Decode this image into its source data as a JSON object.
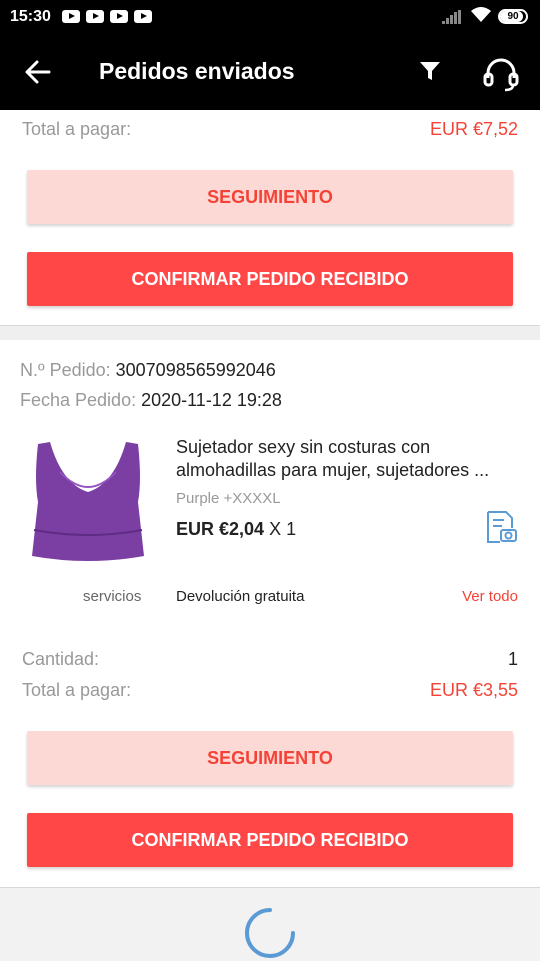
{
  "status_bar": {
    "time": "15:30",
    "notification_icons": [
      "youtube-icon",
      "youtube-icon",
      "youtube-icon",
      "youtube-icon"
    ],
    "battery_level": "90"
  },
  "app_bar": {
    "title": "Pedidos enviados",
    "back_icon": "arrow-left-icon",
    "filter_icon": "filter-icon",
    "support_icon": "headset-icon"
  },
  "previous_order": {
    "total_label": "Total a pagar:",
    "total_value": "EUR €7,52",
    "tracking_button": "SEGUIMIENTO",
    "confirm_button": "CONFIRMAR PEDIDO RECIBIDO"
  },
  "order": {
    "number_label": "N.º Pedido:",
    "number_value": "3007098565992046",
    "date_label": "Fecha Pedido:",
    "date_value": "2020-11-12 19:28",
    "product": {
      "title": "Sujetador sexy sin costuras con almohadillas para mujer, sujetadores ...",
      "variant": "Purple +XXXXL",
      "price": "EUR €2,04",
      "quantity_text": "X 1",
      "image_color": "#7b3fa3"
    },
    "services_label": "servicios",
    "services_value": "Devolución gratuita",
    "see_all": "Ver todo",
    "quantity_label": "Cantidad:",
    "quantity_value": "1",
    "total_label": "Total a pagar:",
    "total_value": "EUR €3,55",
    "tracking_button": "SEGUIMIENTO",
    "confirm_button": "CONFIRMAR PEDIDO RECIBIDO"
  },
  "colors": {
    "accent": "#f44336",
    "confirm_bg": "#ff4747",
    "tracking_bg": "#fdd9d6",
    "spinner": "#5b9bd5"
  }
}
